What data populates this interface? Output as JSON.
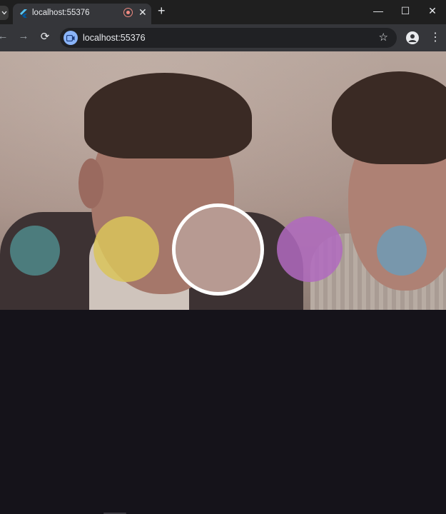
{
  "browser": {
    "tab_title": "localhost:55376",
    "close_tab_glyph": "✕",
    "new_tab_glyph": "+",
    "url": "localhost:55376",
    "window_controls": {
      "minimize": "—",
      "maximize": "☐",
      "close": "✕"
    },
    "nav": {
      "back": "←",
      "forward": "→",
      "reload": "⟳"
    },
    "bookmark_glyph": "☆",
    "menu_glyph": "⋮"
  },
  "camera": {
    "filters": [
      {
        "name": "teal-filter",
        "color": "#4f8a8b"
      },
      {
        "name": "yellow-filter",
        "color": "#d9c45a"
      },
      {
        "name": "normal-filter",
        "color": "#b79a92",
        "selected": true
      },
      {
        "name": "purple-filter",
        "color": "#b06ac0"
      },
      {
        "name": "blue-filter",
        "color": "#6f9bb6"
      }
    ]
  }
}
